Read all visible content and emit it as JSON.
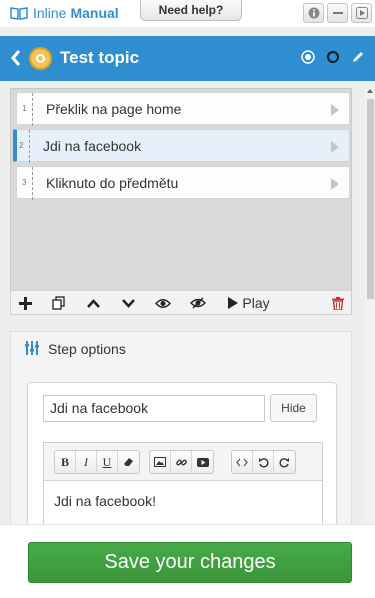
{
  "topbar": {
    "brand_a": "Inline",
    "brand_b": "Manual",
    "help_label": "Need help?",
    "icons": [
      "info-icon",
      "minimize-icon",
      "play-panel-icon"
    ]
  },
  "header": {
    "title": "Test topic",
    "icons": [
      "back-icon",
      "topic-logo-icon",
      "target-icon",
      "circle-icon",
      "edit-icon"
    ]
  },
  "steps": [
    {
      "num": "1",
      "label": "Překlik na page home"
    },
    {
      "num": "2",
      "label": "Jdi na facebook"
    },
    {
      "num": "3",
      "label": "Kliknuto do předmětu"
    }
  ],
  "toolbar": {
    "play_label": "Play",
    "icons": [
      "add-icon",
      "duplicate-icon",
      "move-up-icon",
      "move-down-icon",
      "view-icon",
      "hide-view-icon",
      "play-icon",
      "delete-icon"
    ]
  },
  "step_options": {
    "title": "Step options",
    "step_title_value": "Jdi na facebook",
    "hide_label": "Hide",
    "editor_buttons": [
      "B",
      "I",
      "U"
    ],
    "editor_content": "Jdi na facebook!"
  },
  "footer": {
    "save_label": "Save your changes"
  },
  "colors": {
    "accent": "#2e8ecf",
    "save": "#3f9e3f",
    "delete": "#d9302c"
  }
}
